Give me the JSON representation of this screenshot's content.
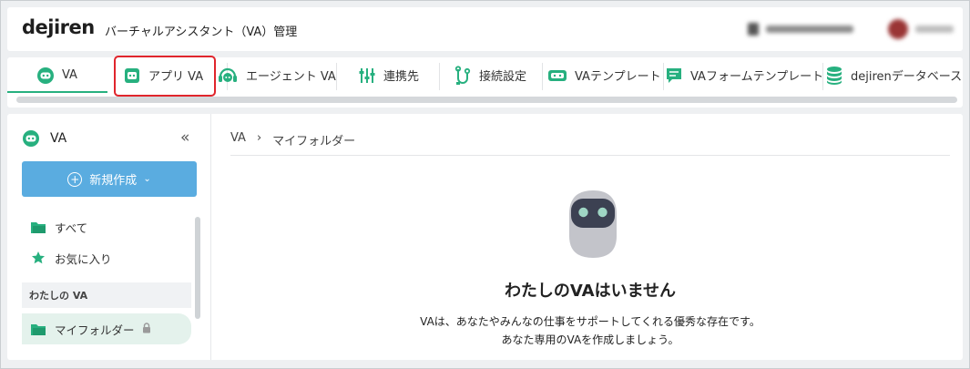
{
  "header": {
    "logo": "dejiren",
    "title": "バーチャルアシスタント（VA）管理"
  },
  "tabs": [
    {
      "label": "VA",
      "icon": "robot-face-icon",
      "active": true
    },
    {
      "label": "アプリ VA",
      "icon": "app-robot-icon",
      "active": false
    },
    {
      "label": "エージェント VA",
      "icon": "headset-icon",
      "active": false
    },
    {
      "label": "連携先",
      "icon": "sliders-icon",
      "active": false
    },
    {
      "label": "接続設定",
      "icon": "connection-icon",
      "active": false
    },
    {
      "label": "VAテンプレート",
      "icon": "template-icon",
      "active": false
    },
    {
      "label": "VAフォームテンプレート",
      "icon": "form-chat-icon",
      "active": false
    },
    {
      "label": "dejirenデータベース",
      "icon": "database-icon",
      "active": false
    }
  ],
  "sidebar": {
    "title": "VA",
    "new_button": "新規作成",
    "items": [
      {
        "label": "すべて",
        "icon": "folder-icon"
      },
      {
        "label": "お気に入り",
        "icon": "star-icon"
      }
    ],
    "section_label": "わたしの VA",
    "my_folder": "マイフォルダー"
  },
  "breadcrumb": [
    "VA",
    "›",
    "マイフォルダー"
  ],
  "empty_state": {
    "title": "わたしのVAはいません",
    "line1": "VAは、あなたやみんなの仕事をサポートしてくれる優秀な存在です。",
    "line2": "あなた専用のVAを作成しましょう。"
  },
  "colors": {
    "accent_green": "#27b07f",
    "primary_button": "#5aace0",
    "highlight_red": "#e0252c"
  }
}
